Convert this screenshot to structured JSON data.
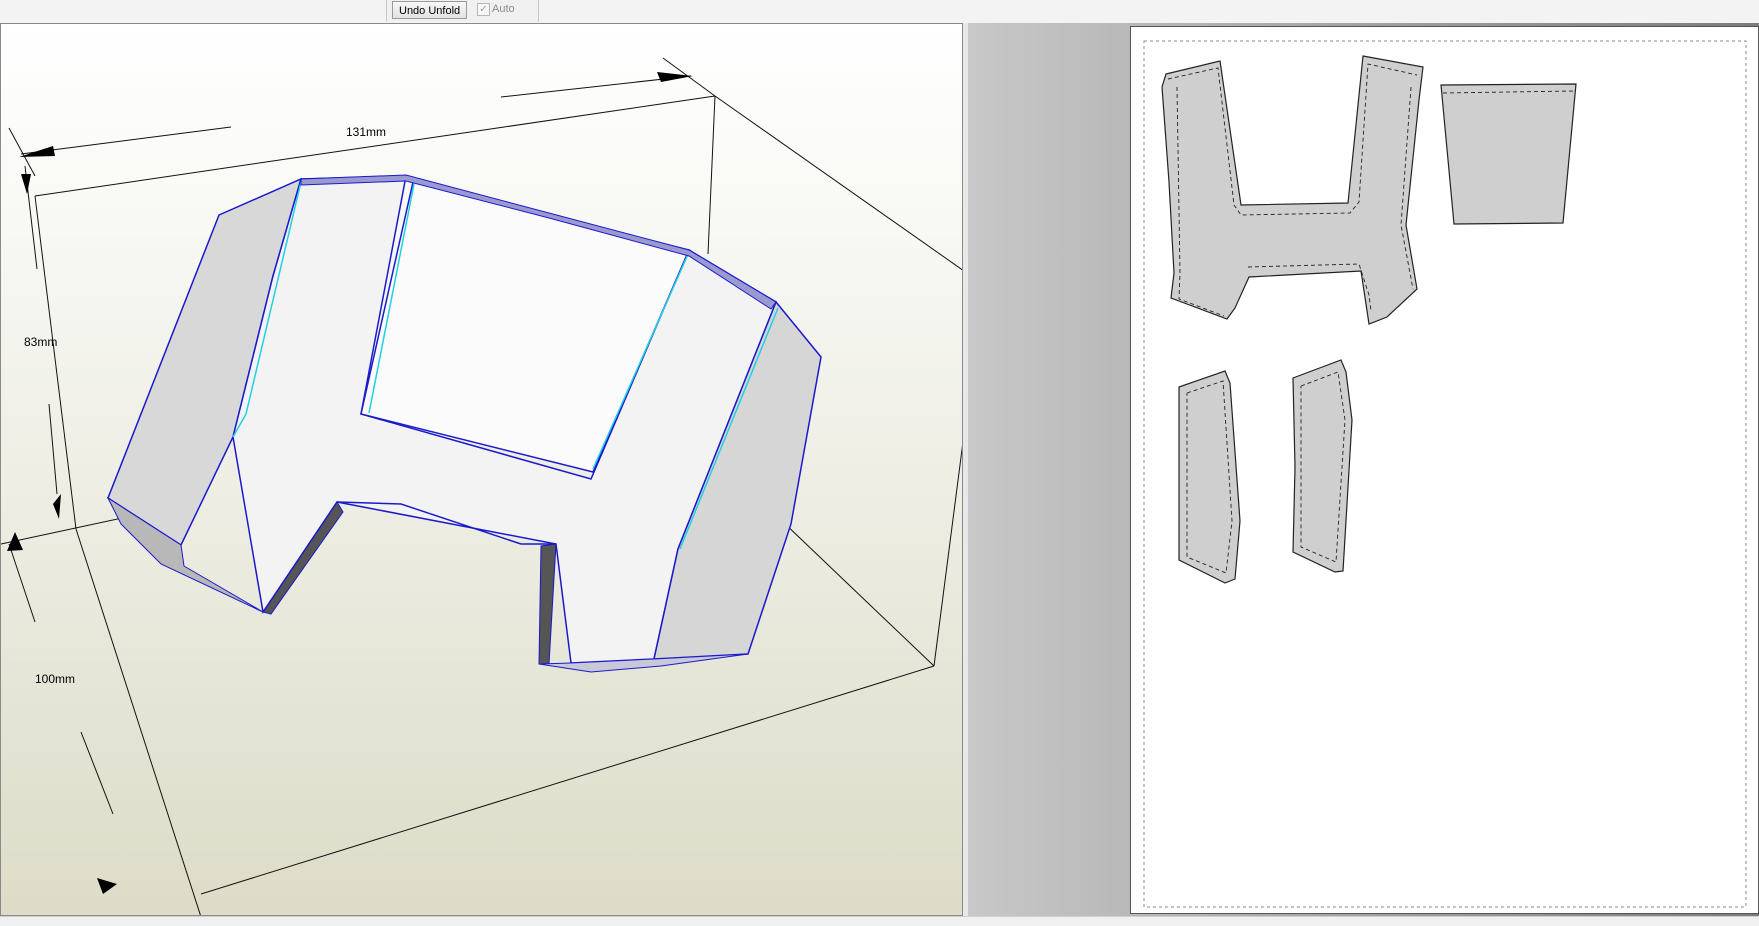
{
  "toolbar": {
    "undo_unfold_label": "Undo Unfold",
    "auto_label": "Auto",
    "auto_checked": true
  },
  "view3d": {
    "dimensions": {
      "width": "131mm",
      "height": "83mm",
      "depth": "100mm"
    }
  },
  "view2d": {
    "parts": [
      {
        "name": "h-shaped-part"
      },
      {
        "name": "trapezoid-part"
      },
      {
        "name": "side-strip-left"
      },
      {
        "name": "side-strip-right"
      }
    ]
  },
  "colors": {
    "part_fill": "#cfcfcf",
    "model_edge": "#1a1acc",
    "model_fold_edge": "#22d0e0",
    "paper": "#ffffff"
  }
}
